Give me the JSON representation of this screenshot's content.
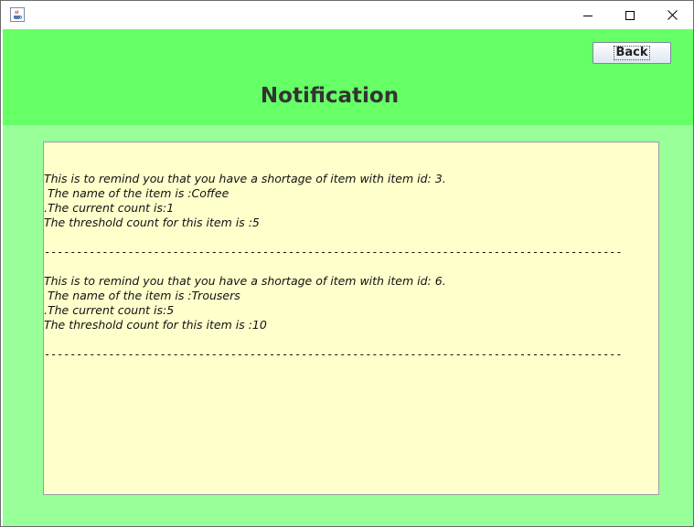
{
  "window": {
    "icon": "java-cup-icon"
  },
  "header": {
    "back_label": "Back",
    "title": "Notification"
  },
  "notifications": [
    {
      "lines": [
        "This is to remind you that you have a shortage of item with item id: 3.",
        " The name of the item is :Coffee",
        ".The current count is:1",
        "The threshold count for this item is :5"
      ]
    },
    {
      "lines": [
        "This is to remind you that you have a shortage of item with item id: 6.",
        " The name of the item is :Trousers",
        ".The current count is:5",
        "The threshold count for this item is :10"
      ]
    }
  ],
  "separator": "------------------------------------------------------------------------------------------",
  "colors": {
    "header_bg": "#66ff66",
    "content_bg": "#99ff99",
    "textarea_bg": "#ffffcc"
  }
}
